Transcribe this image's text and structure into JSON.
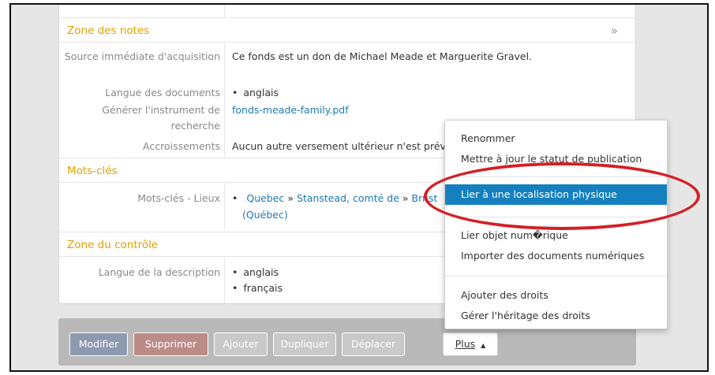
{
  "sections": {
    "notes": {
      "title": "Zone des notes",
      "chevron": "»",
      "source_label": "Source immédiate d'acquisition",
      "source_value": "Ce fonds est un don de Michael Meade et Marguerite Gravel.",
      "langdocs_label": "Langue des documents",
      "langdocs_value": "anglais",
      "finding_label": "Générer l'instrument de recherche",
      "finding_value": "fonds-meade-family.pdf",
      "accruals_label": "Accroissements",
      "accruals_value": "Aucun autre versement ultérieur n'est prév"
    },
    "keywords": {
      "title": "Mots-clés",
      "places_label": "Mots-clés - Lieux",
      "place1": "Quebec",
      "sep1": "»",
      "place2": "Stanstead, comté de",
      "sep2": "»",
      "place3": "B",
      "place4": "rnst",
      "place_line2": "(Québec)"
    },
    "control": {
      "title": "Zone du contrôle",
      "lang_label": "Langue de la description",
      "lang1": "anglais",
      "lang2": "français"
    }
  },
  "menu": {
    "items": [
      "Renommer",
      "Mettre à jour le statut de publication",
      "Lier à une localisation physique",
      "Lier objet num�rique",
      "Importer des documents numériques",
      "Ajouter des droits",
      "Gérer l'héritage des droits"
    ]
  },
  "toolbar": {
    "modify": "Modifier",
    "delete": "Supprimer",
    "add": "Ajouter",
    "duplicate": "Dupliquer",
    "move": "Déplacer",
    "more": "Plus",
    "more_caret": "▲"
  },
  "colors": {
    "section_title": "#e0a100",
    "link": "#1b7ab3",
    "menu_active": "#1580bf",
    "highlight_ellipse": "#d41f26",
    "modify_button": "#8c9ab0",
    "delete_button": "#bb8c87"
  }
}
